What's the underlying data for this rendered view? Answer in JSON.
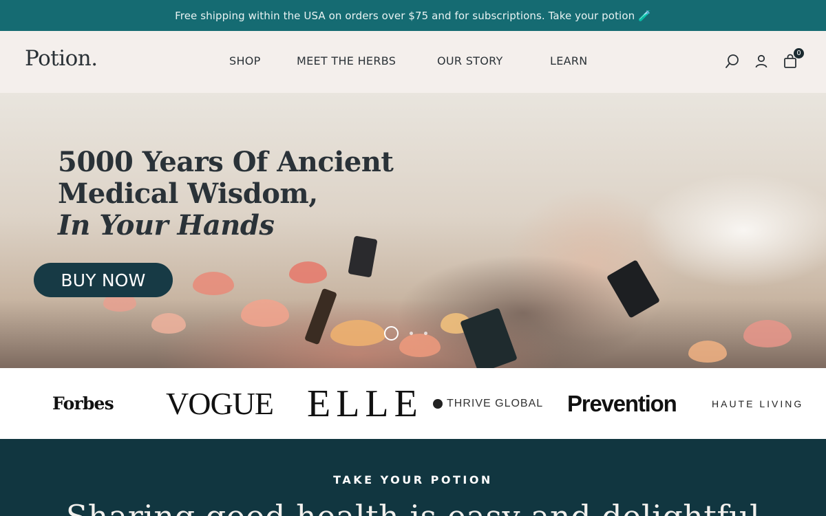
{
  "announcement": {
    "text": "Free shipping within the USA on orders over $75 and for subscriptions. Take your potion 🧪"
  },
  "header": {
    "logo": "Potion.",
    "nav": [
      {
        "label": "SHOP"
      },
      {
        "label": "MEET THE HERBS"
      },
      {
        "label": "OUR STORY"
      },
      {
        "label": "LEARN"
      }
    ],
    "icons": [
      "search-icon",
      "account-icon",
      "cart-icon"
    ],
    "cart_count": "0"
  },
  "hero": {
    "title_line1": "5000 Years Of Ancient",
    "title_line2": "Medical Wisdom,",
    "title_line3": "In Your Hands",
    "button_label": "BUY NOW",
    "slides_total": 3,
    "active_slide": 1
  },
  "press": {
    "logos": [
      "Forbes",
      "VOGUE",
      "ELLE",
      "THRIVE GLOBAL",
      "Prevention",
      "HAUTE LIVING"
    ]
  },
  "take_section": {
    "eyebrow": "TAKE YOUR POTION",
    "headline": "Sharing good health is easy and delightful"
  },
  "colors": {
    "announcement_bg": "#156b72",
    "header_bg": "#f4efec",
    "button_bg": "#173a45",
    "section_bg": "#113640"
  }
}
